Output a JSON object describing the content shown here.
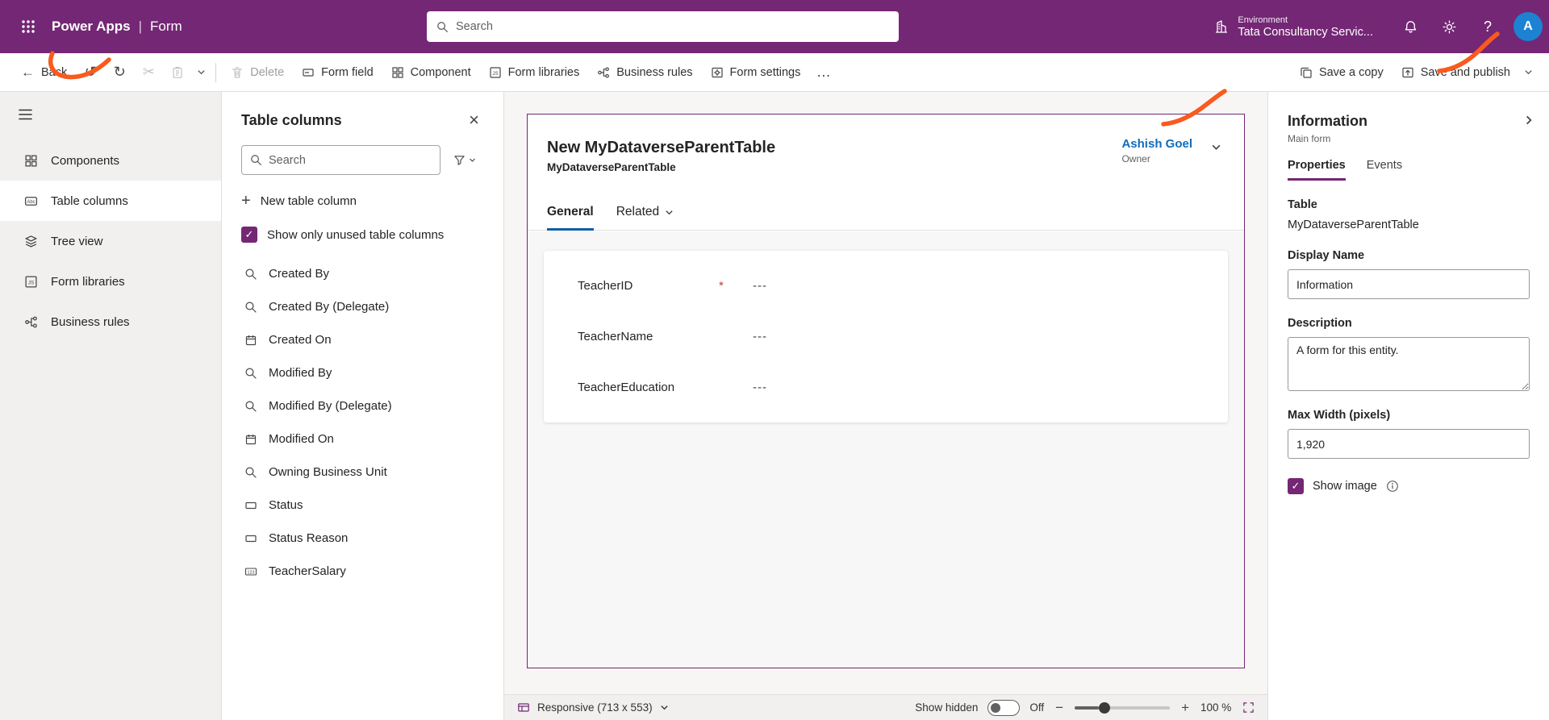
{
  "header": {
    "app_title": "Power Apps",
    "divider": "|",
    "page_title": "Form",
    "search_placeholder": "Search",
    "environment_label": "Environment",
    "environment_name": "Tata Consultancy Servic...",
    "avatar_initial": "A"
  },
  "command_bar": {
    "back_label": "Back",
    "commands": [
      {
        "label": "Delete",
        "disabled": true
      },
      {
        "label": "Form field"
      },
      {
        "label": "Component"
      },
      {
        "label": "Form libraries"
      },
      {
        "label": "Business rules"
      },
      {
        "label": "Form settings"
      }
    ],
    "save_copy_label": "Save a copy",
    "save_publish_label": "Save and publish"
  },
  "sidebar": {
    "items": [
      {
        "label": "Components",
        "selected": false
      },
      {
        "label": "Table columns",
        "selected": true
      },
      {
        "label": "Tree view",
        "selected": false
      },
      {
        "label": "Form libraries",
        "selected": false
      },
      {
        "label": "Business rules",
        "selected": false
      }
    ]
  },
  "columns_panel": {
    "title": "Table columns",
    "search_placeholder": "Search",
    "new_column_label": "New table column",
    "unused_filter_label": "Show only unused table columns",
    "unused_filter_checked": true,
    "items": [
      {
        "label": "Created By",
        "icon": "lookup-icon"
      },
      {
        "label": "Created By (Delegate)",
        "icon": "lookup-icon"
      },
      {
        "label": "Created On",
        "icon": "datetime-icon"
      },
      {
        "label": "Modified By",
        "icon": "lookup-icon"
      },
      {
        "label": "Modified By (Delegate)",
        "icon": "lookup-icon"
      },
      {
        "label": "Modified On",
        "icon": "datetime-icon"
      },
      {
        "label": "Owning Business Unit",
        "icon": "lookup-icon"
      },
      {
        "label": "Status",
        "icon": "choice-icon"
      },
      {
        "label": "Status Reason",
        "icon": "choice-icon"
      },
      {
        "label": "TeacherSalary",
        "icon": "number-icon"
      }
    ]
  },
  "form_preview": {
    "title": "New MyDataverseParentTable",
    "subtitle": "MyDataverseParentTable",
    "owner_name": "Ashish Goel",
    "owner_label": "Owner",
    "tabs": [
      {
        "label": "General",
        "selected": true
      },
      {
        "label": "Related",
        "selected": false
      }
    ],
    "fields": [
      {
        "label": "TeacherID",
        "required_mark": "*",
        "value": "---"
      },
      {
        "label": "TeacherName",
        "required_mark": "",
        "value": "---"
      },
      {
        "label": "TeacherEducation",
        "required_mark": "",
        "value": "---"
      }
    ]
  },
  "status_bar": {
    "responsive_label": "Responsive (713 x 553)",
    "show_hidden_label": "Show hidden",
    "toggle_state": "Off",
    "zoom_level": "100 %"
  },
  "properties_panel": {
    "title": "Information",
    "subtitle": "Main form",
    "tabs": [
      {
        "label": "Properties",
        "selected": true
      },
      {
        "label": "Events",
        "selected": false
      }
    ],
    "table_label": "Table",
    "table_value": "MyDataverseParentTable",
    "display_name_label": "Display Name",
    "display_name_value": "Information",
    "description_label": "Description",
    "description_value": "A form for this entity.",
    "max_width_label": "Max Width (pixels)",
    "max_width_value": "1,920",
    "show_image_label": "Show image",
    "show_image_checked": true
  },
  "glyphs": {
    "back": "←",
    "undo": "↺",
    "redo": "↻",
    "cut": "✂",
    "overflow": "…",
    "close": "×",
    "plus": "+",
    "minus": "−",
    "zoom_in": "+",
    "check": "✓",
    "help": "?"
  },
  "colors": {
    "header_bg": "#742774",
    "accent_purple": "#742774",
    "preview_blue": "#115ea3",
    "link_blue": "#0f6cbd",
    "annotation_orange": "#f95a1d",
    "required_red": "#d13438",
    "avatar_blue": "#1d82d2"
  }
}
